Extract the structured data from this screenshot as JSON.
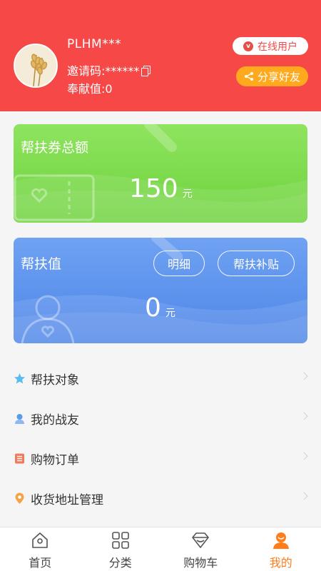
{
  "header": {
    "username": "PLHM***",
    "invite_code_text": "邀请码:******",
    "contribution_text": "奉献值:0",
    "online_badge": "在线用户",
    "online_badge_letter": "v",
    "share_button": "分享好友"
  },
  "cards": {
    "voucher": {
      "title": "帮扶券总额",
      "amount": "150",
      "unit": "元"
    },
    "support": {
      "title": "帮扶值",
      "amount": "0",
      "unit": "元",
      "detail_button": "明细",
      "subsidy_button": "帮扶补贴"
    }
  },
  "menu": {
    "items": [
      {
        "label": "帮扶对象",
        "icon": "star-icon",
        "color": "#5bbcf0"
      },
      {
        "label": "我的战友",
        "icon": "person-icon",
        "color": "#5b9ae8"
      },
      {
        "label": "购物订单",
        "icon": "order-list-icon",
        "color": "#f07b5c"
      },
      {
        "label": "收货地址管理",
        "icon": "location-pin-icon",
        "color": "#f3a446"
      }
    ]
  },
  "tabbar": {
    "tabs": [
      {
        "label": "首页",
        "icon": "home-icon"
      },
      {
        "label": "分类",
        "icon": "grid-icon"
      },
      {
        "label": "购物车",
        "icon": "cart-icon"
      },
      {
        "label": "我的",
        "icon": "profile-icon",
        "active": true
      }
    ]
  },
  "colors": {
    "header": "#f74848",
    "accent": "#ff7d1a",
    "green_card": "#7ad848",
    "blue_card": "#5a8fea",
    "share": "#ffaa1e"
  }
}
